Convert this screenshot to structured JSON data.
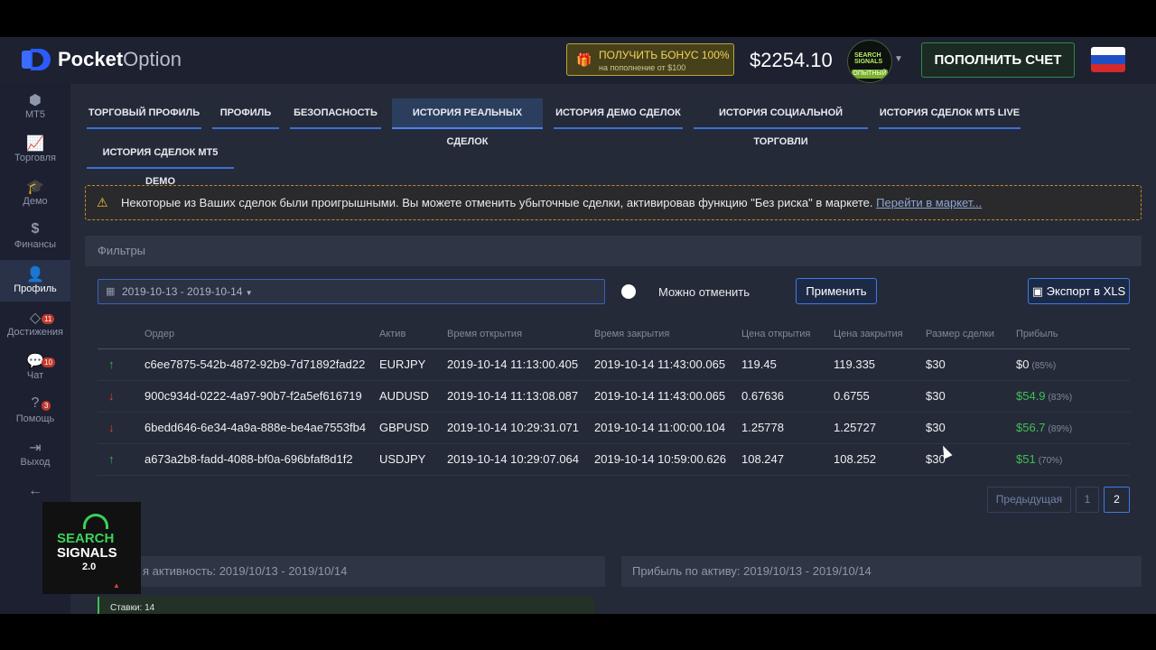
{
  "header": {
    "logo_bold": "Pocket",
    "logo_light": "Option",
    "bonus_line1": "ПОЛУЧИТЬ БОНУС 100%",
    "bonus_line2": "на пополнение от $100",
    "balance": "$2254.10",
    "avatar_text": "SEARCH SIGNALS",
    "avatar_level": "ОПЫТНЫЙ",
    "deposit_label": "ПОПОЛНИТЬ СЧЕТ"
  },
  "sidebar": {
    "items": [
      {
        "label": "MT5",
        "icon": "mt5-icon"
      },
      {
        "label": "Торговля",
        "icon": "chart-icon"
      },
      {
        "label": "Демо",
        "icon": "graduation-cap-icon"
      },
      {
        "label": "Финансы",
        "icon": "dollar-icon"
      },
      {
        "label": "Профиль",
        "icon": "user-icon"
      },
      {
        "label": "Достижения",
        "icon": "diamond-icon",
        "badge": "11"
      },
      {
        "label": "Чат",
        "icon": "chat-icon",
        "badge": "10"
      },
      {
        "label": "Помощь",
        "icon": "help-icon",
        "badge": "3"
      },
      {
        "label": "Выход",
        "icon": "logout-icon"
      }
    ],
    "collapse_icon": "arrow-left-icon"
  },
  "tabs": [
    "ТОРГОВЫЙ ПРОФИЛЬ",
    "ПРОФИЛЬ",
    "БЕЗОПАСНОСТЬ",
    "ИСТОРИЯ РЕАЛЬНЫХ СДЕЛОК",
    "ИСТОРИЯ ДЕМО СДЕЛОК",
    "ИСТОРИЯ СОЦИАЛЬНОЙ ТОРГОВЛИ",
    "ИСТОРИЯ СДЕЛОК MT5 LIVE",
    "ИСТОРИЯ СДЕЛОК MT5 DEMO"
  ],
  "active_tab": "ИСТОРИЯ РЕАЛЬНЫХ СДЕЛОК",
  "warning": {
    "text": "Некоторые из Ваших сделок были проигрышными. Вы можете отменить убыточные сделки, активировав функцию \"Без риска\" в маркете.",
    "link": "Перейти в маркет..."
  },
  "filters": {
    "title": "Фильтры",
    "date_range": "2019-10-13 - 2019-10-14",
    "toggle_label": "Можно отменить",
    "apply_label": "Применить",
    "export_label": "Экспорт в XLS"
  },
  "table": {
    "headers": [
      "Ордер",
      "Актив",
      "Время открытия",
      "Время закрытия",
      "Цена открытия",
      "Цена закрытия",
      "Размер сделки",
      "Прибыль"
    ],
    "rows": [
      {
        "dir": "up",
        "order": "c6ee7875-542b-4872-92b9-7d71892fad22",
        "asset": "EURJPY",
        "open_time": "2019-10-14 11:13:00.405",
        "close_time": "2019-10-14 11:43:00.065",
        "open_price": "119.45",
        "close_price": "119.335",
        "size": "$30",
        "profit": "$0",
        "pct": "(85%)",
        "profit_color": "#eef0f5"
      },
      {
        "dir": "down",
        "order": "900c934d-0222-4a97-90b7-f2a5ef616719",
        "asset": "AUDUSD",
        "open_time": "2019-10-14 11:13:08.087",
        "close_time": "2019-10-14 11:43:00.065",
        "open_price": "0.67636",
        "close_price": "0.6755",
        "size": "$30",
        "profit": "$54.9",
        "pct": "(83%)",
        "profit_color": "#3fbf55"
      },
      {
        "dir": "down",
        "order": "6bedd646-6e34-4a9a-888e-be4ae7553fb4",
        "asset": "GBPUSD",
        "open_time": "2019-10-14 10:29:31.071",
        "close_time": "2019-10-14 11:00:00.104",
        "open_price": "1.25778",
        "close_price": "1.25727",
        "size": "$30",
        "profit": "$56.7",
        "pct": "(89%)",
        "profit_color": "#3fbf55"
      },
      {
        "dir": "up",
        "order": "a673a2b8-fadd-4088-bf0a-696bfaf8d1f2",
        "asset": "USDJPY",
        "open_time": "2019-10-14 10:29:07.064",
        "close_time": "2019-10-14 10:59:00.626",
        "open_price": "108.247",
        "close_price": "108.252",
        "size": "$30",
        "profit": "$51",
        "pct": "(70%)",
        "profit_color": "#3fbf55"
      }
    ]
  },
  "pagination": {
    "prev": "Предыдущая",
    "pages": [
      "1",
      "2"
    ],
    "current": "2"
  },
  "bottom_panels": {
    "left_title": "я активность: 2019/10/13 - 2019/10/14",
    "left_stat": "Ставки: 14",
    "right_title": "Прибыль по активу: 2019/10/13 - 2019/10/14"
  },
  "overlay": {
    "line1": "SEARCH",
    "line2": "SIGNALS",
    "line3": "2.0"
  },
  "colors": {
    "accent": "#3d7ae8",
    "profit": "#3fbf55",
    "loss": "#e0433a",
    "bonus": "#f1d35a"
  }
}
